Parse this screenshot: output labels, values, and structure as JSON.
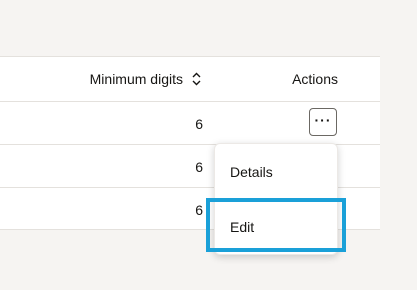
{
  "table": {
    "columns": {
      "minimum_digits": "Minimum digits",
      "actions": "Actions"
    },
    "rows": [
      {
        "minimum_digits": "6"
      },
      {
        "minimum_digits": "6"
      },
      {
        "minimum_digits": "6"
      }
    ],
    "row_action_label": "···"
  },
  "action_menu": {
    "items": [
      {
        "label": "Details"
      },
      {
        "label": "Edit"
      }
    ],
    "focused_item": "Edit"
  },
  "colors": {
    "page_background": "#f6f4f2",
    "panel_background": "#ffffff",
    "divider": "#e4e1dd",
    "focus_highlight": "#1aa0d8",
    "text": "#161513"
  },
  "icons": {
    "sort": "sort-icon",
    "more_actions": "more-actions-icon"
  }
}
